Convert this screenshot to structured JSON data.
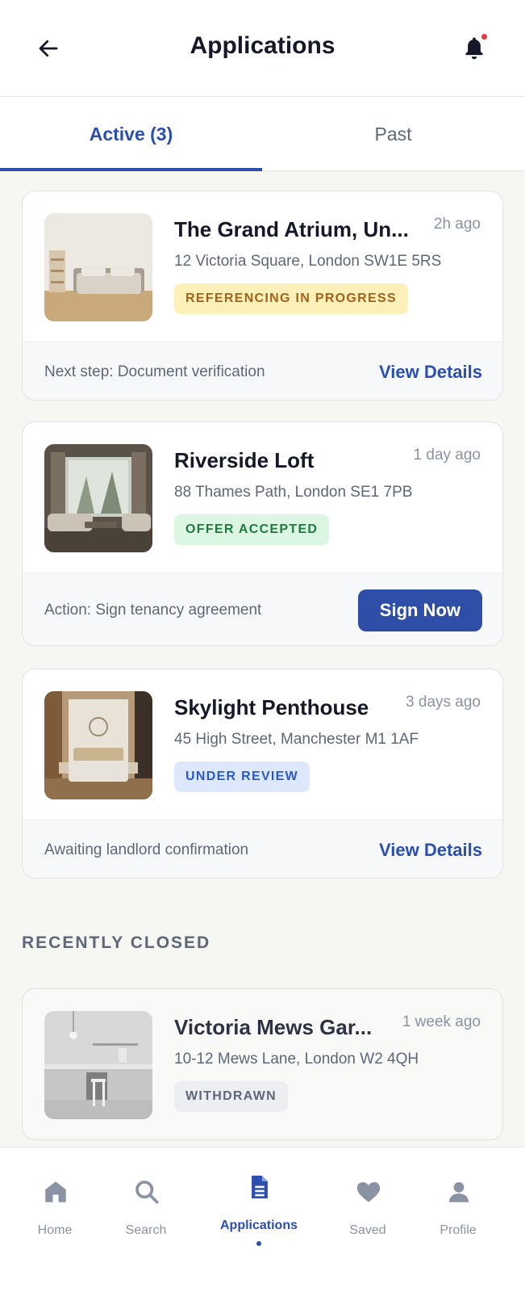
{
  "header": {
    "title": "Applications",
    "back_icon": "arrow-left-icon",
    "notification_icon": "bell-icon",
    "has_unread": true
  },
  "tabs": [
    {
      "label": "Active (3)",
      "active": true
    },
    {
      "label": "Past",
      "active": false
    }
  ],
  "applications": [
    {
      "title": "The Grand Atrium, Un...",
      "time": "2h ago",
      "address": "12 Victoria Square, London SW1E 5RS",
      "status": "REFERENCING IN PROGRESS",
      "footer_text": "Next step: Document verification",
      "action": "View Details",
      "image": "bedroom-photo"
    },
    {
      "title": "Riverside Loft",
      "time": "1 day ago",
      "address": "88 Thames Path, London SE1 7PB",
      "status": "OFFER ACCEPTED",
      "footer_text": "Action: Sign tenancy agreement",
      "action": "Sign Now",
      "image": "living-room-photo"
    },
    {
      "title": "Skylight Penthouse",
      "time": "3 days ago",
      "address": "45 High Street, Manchester M1 1AF",
      "status": "UNDER REVIEW",
      "footer_text": "Awaiting landlord confirmation",
      "action": "View Details",
      "image": "penthouse-bedroom-photo"
    }
  ],
  "recently_closed": {
    "section_title": "RECENTLY CLOSED",
    "items": [
      {
        "title": "Victoria Mews Gar...",
        "time": "1 week ago",
        "address": "10-12 Mews Lane, London W2 4QH",
        "status": "WITHDRAWN",
        "image": "kitchen-photo"
      }
    ]
  },
  "bottom_nav": [
    {
      "label": "Home",
      "icon": "home-icon",
      "active": false
    },
    {
      "label": "Search",
      "icon": "search-icon",
      "active": false
    },
    {
      "label": "Applications",
      "icon": "document-icon",
      "active": true
    },
    {
      "label": "Saved",
      "icon": "heart-icon",
      "active": false
    },
    {
      "label": "Profile",
      "icon": "user-icon",
      "active": false
    }
  ],
  "colors": {
    "accent": "#2a4fb0",
    "background": "#f6f6f2",
    "status_referencing": "#a2621a",
    "status_accepted": "#1e7a3a",
    "status_review": "#2b59c3",
    "status_withdrawn": "#5d6779"
  }
}
